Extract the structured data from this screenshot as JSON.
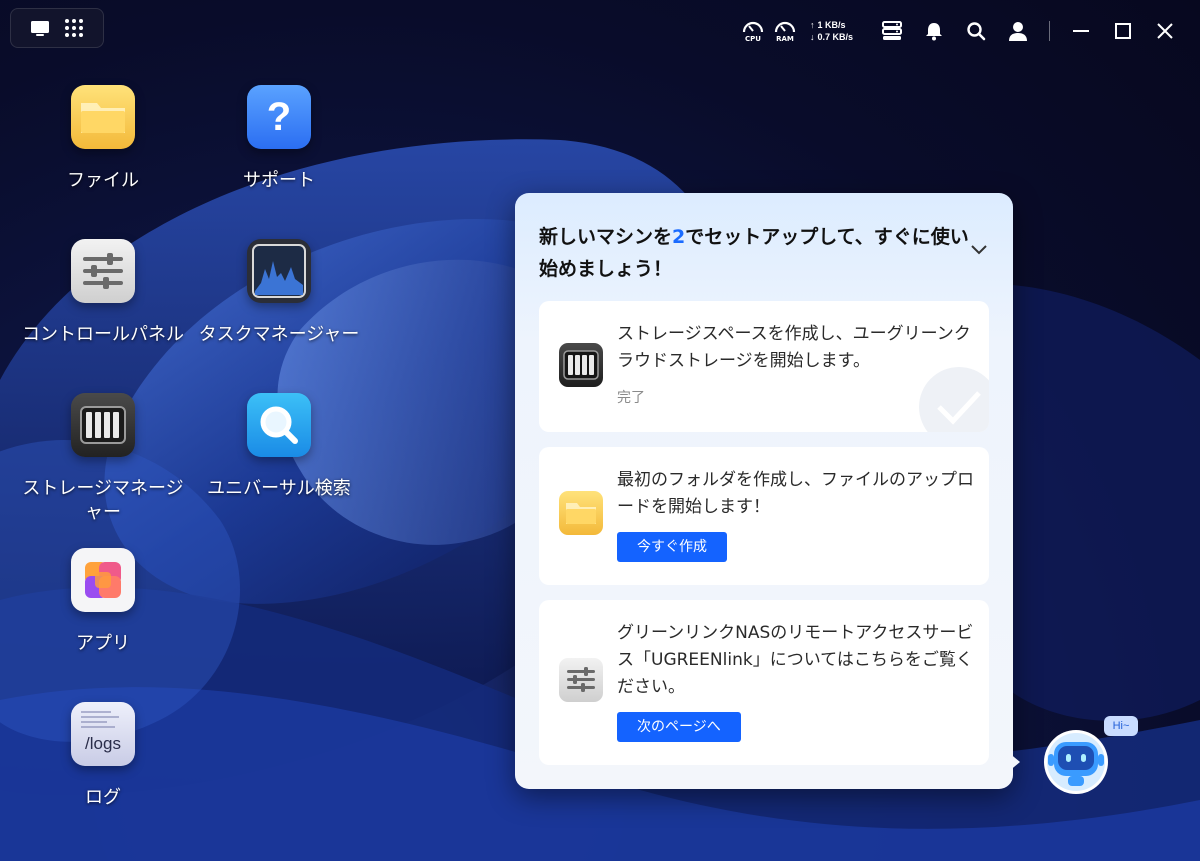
{
  "topbar": {
    "cpu_label": "CPU",
    "ram_label": "RAM",
    "upload_speed": "1 KB/s",
    "download_speed": "0.7 KB/s"
  },
  "desktop": {
    "icons": [
      {
        "label": "ファイル",
        "icon": "folder-icon"
      },
      {
        "label": "サポート",
        "icon": "help-icon"
      },
      {
        "label": "コントロールパネル",
        "icon": "sliders-icon"
      },
      {
        "label": "タスクマネージャー",
        "icon": "chart-icon"
      },
      {
        "label": "ストレージマネージャー",
        "label_line1": "ストレージマネージ",
        "label_line2": "ャー",
        "icon": "storage-icon"
      },
      {
        "label": "ユニバーサル検索",
        "icon": "search-icon"
      },
      {
        "label": "アプリ",
        "icon": "apps-icon"
      },
      {
        "label": "ログ",
        "icon": "logs-icon",
        "tile_text": "/logs"
      }
    ]
  },
  "panel": {
    "title_before": "新しいマシンを",
    "title_num": "2",
    "title_after": "でセットアップして、すぐに使い始めましょう！",
    "cards": [
      {
        "text": "ストレージスペースを作成し、ユーグリーンクラウドストレージを開始します。",
        "status": "完了",
        "icon": "storage-icon"
      },
      {
        "text": "最初のフォルダを作成し、ファイルのアップロードを開始します！",
        "button": "今すぐ作成",
        "icon": "folder-icon"
      },
      {
        "text": "グリーンリンクNASのリモートアクセスサービス「UGREENlink」についてはこちらをご覧ください。",
        "button": "次のページへ",
        "icon": "sliders-icon"
      }
    ]
  },
  "assistant": {
    "bubble": "Hi~"
  },
  "colors": {
    "accent": "#1463ff",
    "title_num": "#1a6bff"
  }
}
